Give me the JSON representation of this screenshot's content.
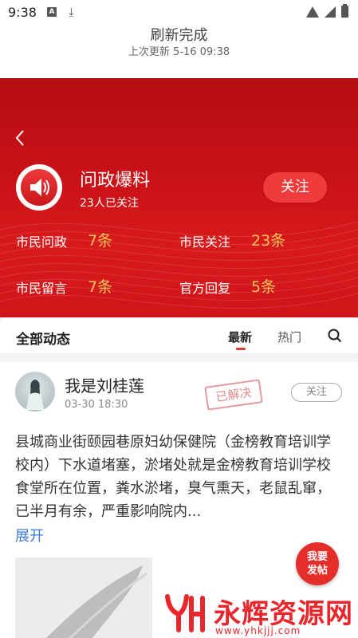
{
  "status_bar": {
    "time": "9:38",
    "icons": [
      "a-icon",
      "download-icon",
      "wifi-icon",
      "signal-icon",
      "battery-icon"
    ]
  },
  "refresh": {
    "title": "刷新完成",
    "subtitle": "上次更新 5-16 09:38"
  },
  "channel": {
    "title": "问政爆料",
    "followers": "23人已关注",
    "follow_label": "关注",
    "stats": [
      {
        "label": "市民问政",
        "value": "7条"
      },
      {
        "label": "市民关注",
        "value": "23条"
      },
      {
        "label": "市民留言",
        "value": "7条"
      },
      {
        "label": "官方回复",
        "value": "5条"
      }
    ],
    "accent_color": "#c81217",
    "stat_value_color": "#f7c35a"
  },
  "feed": {
    "title": "全部动态",
    "tabs": [
      {
        "label": "最新",
        "active": true
      },
      {
        "label": "热门",
        "active": false
      }
    ]
  },
  "post": {
    "author": "我是刘桂莲",
    "time": "03-30 18:30",
    "stamp": "已解决",
    "follow_label": "关注",
    "text": "县城商业街颐园巷原妇幼保健院（金榜教育培训学校内）下水道堵塞，淤堵处就是金榜教育培训学校食堂所在位置，粪水淤堵，臭气熏天，老鼠乱窜，已半月有余，严重影响院内...",
    "expand_label": "展开"
  },
  "fab": {
    "line1": "我要",
    "line2": "发帖"
  },
  "watermark": {
    "text": "永辉资源网",
    "url": "www.yhkjjj.com"
  }
}
